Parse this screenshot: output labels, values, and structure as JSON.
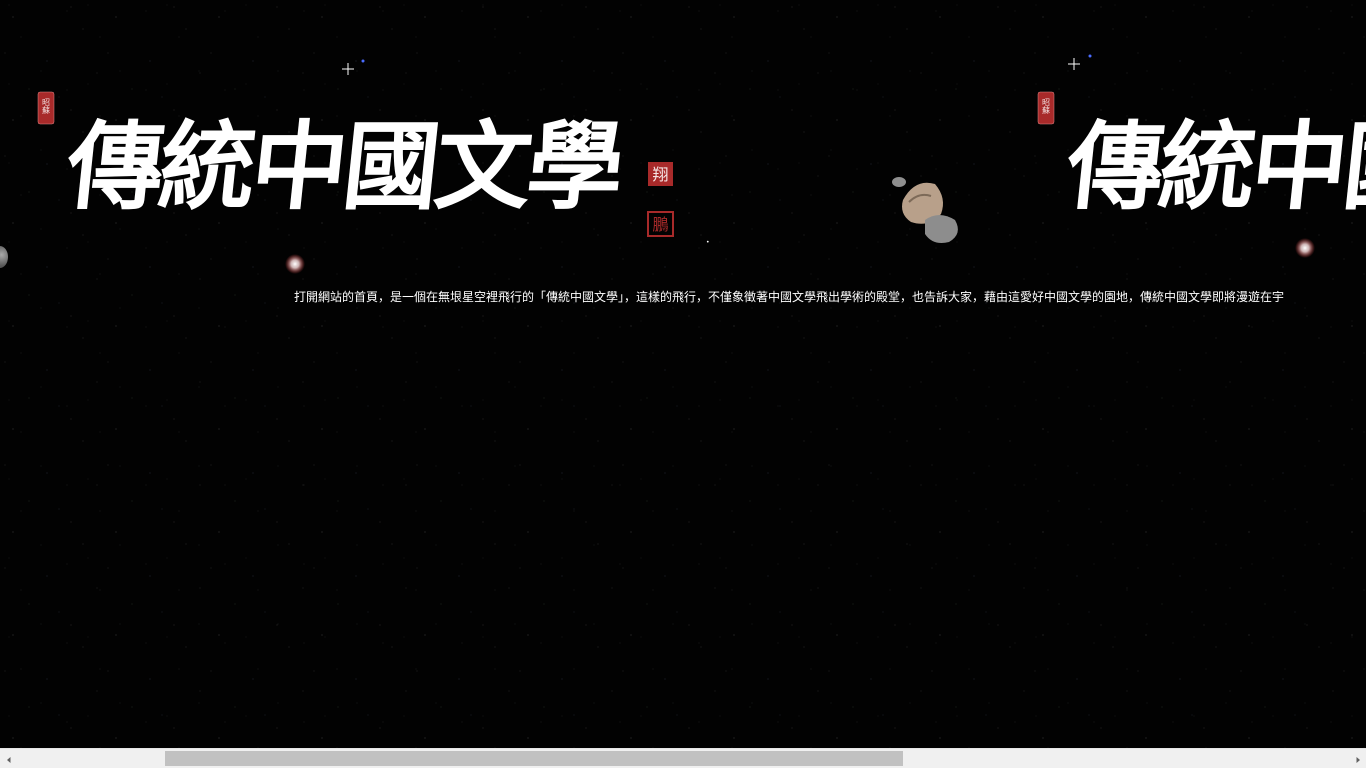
{
  "banner": {
    "title_text": "傳統中國文學",
    "seal_left_text": "昭蘇",
    "seal_right_top_text": "翔",
    "seal_right_bottom_text": "鵬"
  },
  "marquee": {
    "text": "打開網站的首頁，是一個在無垠星空裡飛行的「傳統中國文學」，這樣的飛行，不僅象徵著中國文學飛出學術的殿堂，也告訴大家，藉由這愛好中國文學的園地，傳統中國文學即將漫遊在宇"
  },
  "colors": {
    "background": "#000000",
    "calligraphy": "#ffffff",
    "seal": "#a82a2a",
    "comet": "#ff2020"
  },
  "icons": {
    "scroll_left": "arrow-left-icon",
    "scroll_right": "arrow-right-icon"
  }
}
